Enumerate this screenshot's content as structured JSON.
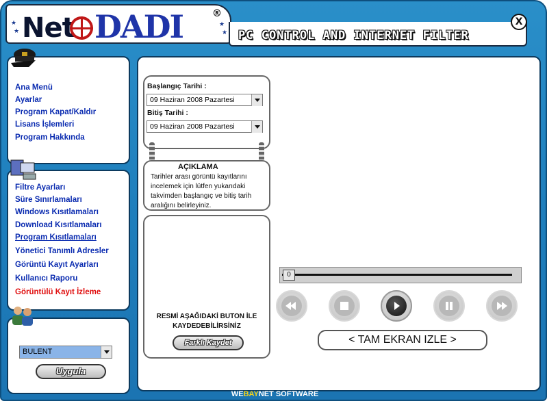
{
  "header": {
    "logo_prefix": "Net",
    "logo_name": "DADI",
    "logo_reg": "®",
    "tagline": "PC CONTROL AND INTERNET FILTER",
    "close_label": "X"
  },
  "sidebar": {
    "main_items": [
      {
        "label": "Ana Menü"
      },
      {
        "label": "Ayarlar"
      },
      {
        "label": "Program Kapat/Kaldır"
      },
      {
        "label": "Lisans İşlemleri"
      },
      {
        "label": "Program Hakkında"
      }
    ],
    "filter_items": [
      {
        "label": "Filtre Ayarları"
      },
      {
        "label": "Süre Sınırlamaları"
      },
      {
        "label": "Windows Kısıtlamaları"
      },
      {
        "label": "Download Kısıtlamaları"
      },
      {
        "label": "Program Kısıtlamaları"
      },
      {
        "label": "Yönetici Tanımlı Adresler"
      },
      {
        "label": "Görüntü Kayıt Ayarları"
      },
      {
        "label": "Kullanıcı Raporu"
      },
      {
        "label": "Görüntülü Kayıt İzleme"
      }
    ],
    "user_select": {
      "value": "BULENT"
    },
    "apply_label": "Uygula"
  },
  "dates": {
    "start_label": "Başlangıç Tarihi :",
    "start_value": "09 Haziran 2008 Pazartesi",
    "end_label": "Bitiş Tarihi :",
    "end_value": "09 Haziran 2008 Pazartesi"
  },
  "description": {
    "title": "AÇIKLAMA",
    "text": "Tarihler arası görüntü kayıtlarını incelemek için lütfen yukarıdaki takvimden başlangıç ve bitiş tarih aralığını belirleyiniz."
  },
  "save": {
    "text": "RESMİ AŞAĞIDAKİ BUTON İLE KAYDEDEBİLİRSİNİZ",
    "button_label": "Farklı Kaydet"
  },
  "player": {
    "slider_value": "0",
    "fullscreen_label": "< TAM EKRAN IZLE >"
  },
  "footer": {
    "brand_a": "WE",
    "brand_b": "BAY",
    "brand_c": "NET SOFTWARE"
  },
  "colors": {
    "frame": "#1f7fbd",
    "menu_link": "#0a2bb0",
    "menu_active": "#e01010",
    "footer_accent": "#f2d21a"
  }
}
